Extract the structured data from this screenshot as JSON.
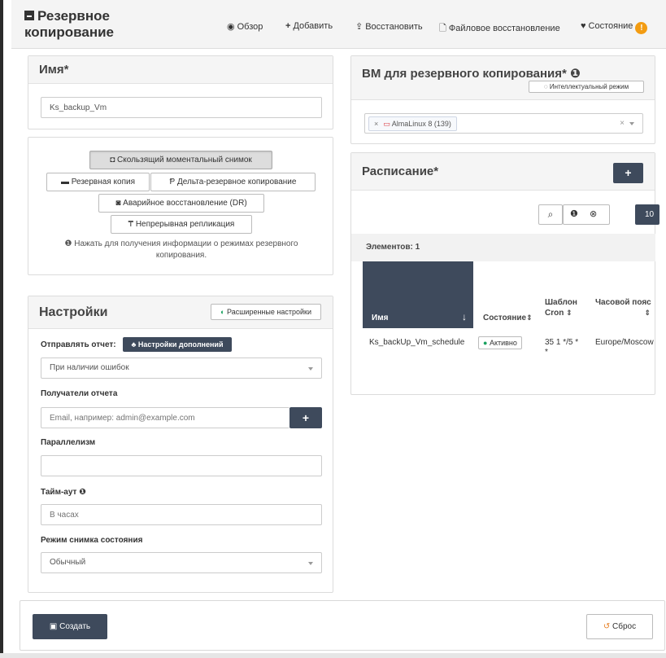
{
  "app": {
    "title": "Резервное копирование"
  },
  "nav": [
    {
      "label": "Обзор",
      "icon": "eye-icon"
    },
    {
      "label": "Добавить",
      "icon": "plus-icon"
    },
    {
      "label": "Восстановить",
      "icon": "upload-icon"
    },
    {
      "label": "Файловое восстановление",
      "icon": "file-icon"
    },
    {
      "label": "Состояние",
      "icon": "heartbeat-icon",
      "badge": "!"
    }
  ],
  "name_panel": {
    "title": "Имя*",
    "value": "Ks_backup_Vm"
  },
  "modes": {
    "snapshot": "Скользящий моментальный снимок",
    "backup": "Резервная копия",
    "delta": "Дельта-резервное копирование",
    "dr": "Аварийное восстановление (DR)",
    "replication": "Непрерывная репликация",
    "info": "Нажать для получения информации о режимах резервного копирования."
  },
  "settings": {
    "title": "Настройки",
    "advanced_toggle": "Расширенные настройки",
    "report_label": "Отправлять отчет:",
    "addons_button": "Настройки дополнений",
    "report_value": "При наличии ошибок",
    "recipients_label": "Получатели отчета",
    "recipients_placeholder": "Email, например: admin@example.com",
    "parallel_label": "Параллелизм",
    "parallel_value": "",
    "timeout_label": "Тайм-аут",
    "timeout_placeholder": "В часах",
    "snapshot_mode_label": "Режим снимка состояния",
    "snapshot_mode_value": "Обычный"
  },
  "vms": {
    "title": "ВМ для резервного копирования*",
    "smart_mode": "Интеллектуальный режим",
    "selected": "AlmaLinux 8 (139)",
    "remove": "×",
    "clear": "×"
  },
  "schedule": {
    "title": "Расписание*",
    "page_size": "10",
    "items_count": "Элементов: 1",
    "columns": {
      "name": "Имя",
      "state": "Состояние",
      "cron": "Шаблон Cron",
      "tz": "Часовой пояс"
    },
    "rows": [
      {
        "name": "Ks_backUp_Vm_schedule",
        "state": "Активно",
        "cron": "35 1 */5 * *",
        "tz": "Europe/Moscow"
      }
    ]
  },
  "footer": {
    "create": "Создать",
    "reset": "Сброс"
  },
  "colors": {
    "dark_button": "#3e4a5c",
    "active_green": "#19a15f",
    "badge_orange": "#f39c12"
  }
}
